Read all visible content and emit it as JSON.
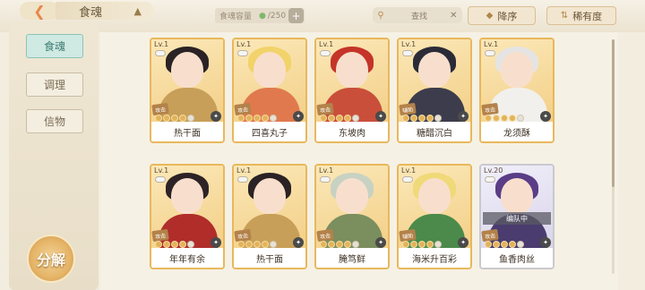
{
  "header": {
    "title": "食魂",
    "capacity_label": "食魂容量",
    "capacity_value": "/250",
    "search_placeholder": "查找",
    "sort_label": "降序",
    "rarity_label": "稀有度"
  },
  "sidebar": {
    "tabs": [
      {
        "label": "食魂",
        "active": true
      },
      {
        "label": "调理",
        "active": false
      },
      {
        "label": "信物",
        "active": false
      }
    ],
    "decompose_label": "分解"
  },
  "cards": [
    {
      "level": "Lv.1",
      "name": "热干面",
      "role": "攻击",
      "stars": 4,
      "hair": "#2a2224",
      "body": "#c79f58",
      "legend": false,
      "team": ""
    },
    {
      "level": "Lv.1",
      "name": "四喜丸子",
      "role": "攻击",
      "stars": 4,
      "hair": "#f1d36a",
      "body": "#e07a4e",
      "legend": false,
      "team": ""
    },
    {
      "level": "Lv.1",
      "name": "东坡肉",
      "role": "攻击",
      "stars": 4,
      "hair": "#c53428",
      "body": "#c94f3a",
      "legend": false,
      "team": ""
    },
    {
      "level": "Lv.1",
      "name": "糖醋沉白",
      "role": "辅助",
      "stars": 4,
      "hair": "#2b2b38",
      "body": "#3c3c4c",
      "legend": false,
      "team": ""
    },
    {
      "level": "Lv.1",
      "name": "龙须酥",
      "role": "攻击",
      "stars": 4,
      "hair": "#e6e4e2",
      "body": "#f2f0ec",
      "legend": false,
      "team": ""
    },
    {
      "level": "Lv.1",
      "name": "年年有余",
      "role": "攻击",
      "stars": 4,
      "hair": "#2d2326",
      "body": "#b02d2a",
      "legend": false,
      "team": ""
    },
    {
      "level": "Lv.1",
      "name": "热干面",
      "role": "攻击",
      "stars": 4,
      "hair": "#2a2224",
      "body": "#c79f58",
      "legend": false,
      "team": ""
    },
    {
      "level": "Lv.1",
      "name": "腌笃鲜",
      "role": "攻击",
      "stars": 4,
      "hair": "#c8d2c2",
      "body": "#7b8e5e",
      "legend": false,
      "team": ""
    },
    {
      "level": "Lv.1",
      "name": "海米升百彩",
      "role": "辅助",
      "stars": 4,
      "hair": "#f0d978",
      "body": "#4b8a4a",
      "legend": false,
      "team": ""
    },
    {
      "level": "Lv.20",
      "name": "鱼香肉丝",
      "role": "攻击",
      "stars": 4,
      "hair": "#5a3d86",
      "body": "#4a3c6e",
      "legend": true,
      "team": "编队中"
    }
  ]
}
